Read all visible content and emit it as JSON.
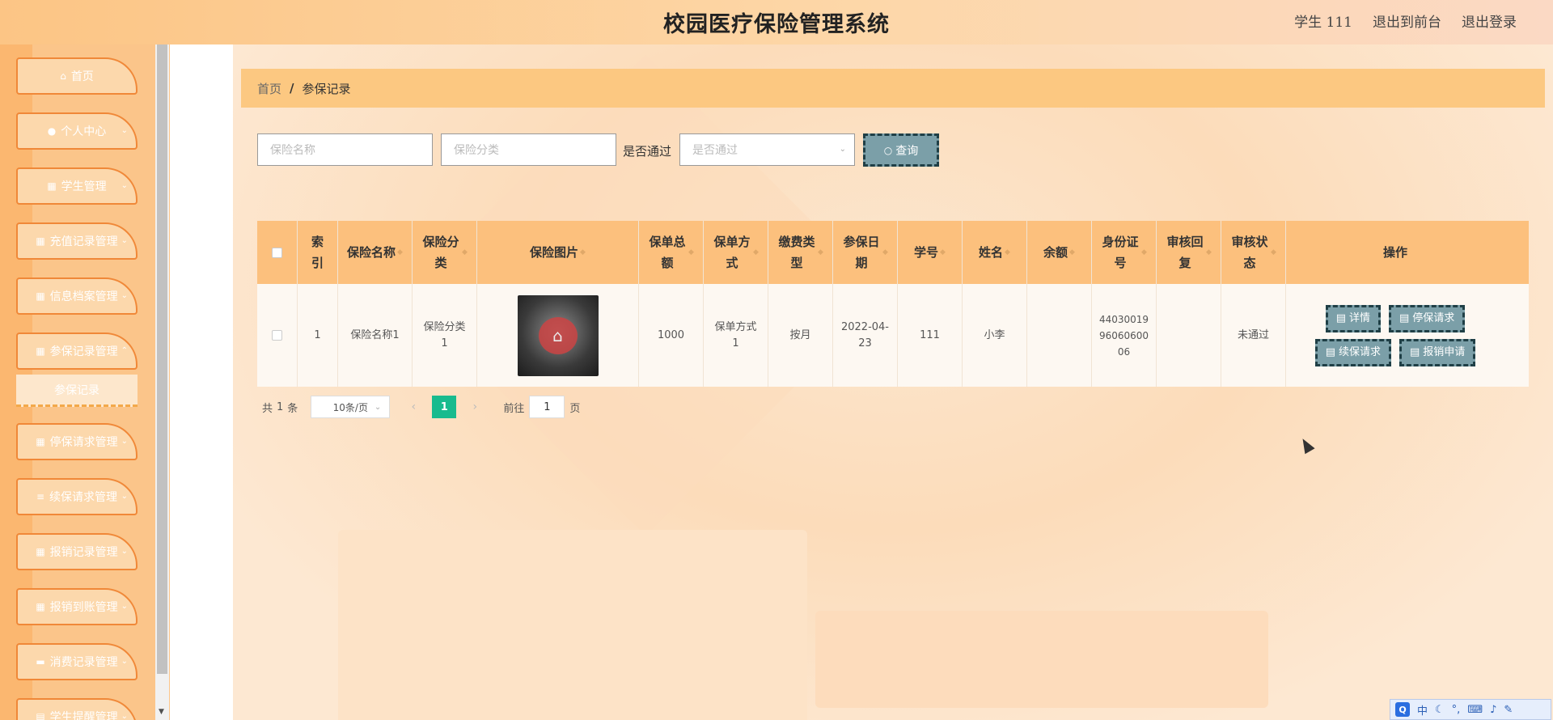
{
  "header": {
    "title": "校园医疗保险管理系统",
    "user": "学生 111",
    "back_to_front": "退出到前台",
    "logout": "退出登录"
  },
  "sidebar": {
    "items": [
      {
        "label": "首页",
        "icon": "home-icon"
      },
      {
        "label": "个人中心",
        "icon": "user-icon"
      },
      {
        "label": "学生管理",
        "icon": "grid-icon"
      },
      {
        "label": "充值记录管理",
        "icon": "grid-icon"
      },
      {
        "label": "信息档案管理",
        "icon": "grid-icon"
      },
      {
        "label": "参保记录管理",
        "icon": "grid-icon"
      },
      {
        "label": "停保请求管理",
        "icon": "grid-icon"
      },
      {
        "label": "续保请求管理",
        "icon": "list-icon"
      },
      {
        "label": "报销记录管理",
        "icon": "grid-icon"
      },
      {
        "label": "报销到账管理",
        "icon": "grid-icon"
      },
      {
        "label": "消费记录管理",
        "icon": "ticket-icon"
      },
      {
        "label": "学生提醒管理",
        "icon": "doc-icon"
      }
    ],
    "active_sub": "参保记录"
  },
  "breadcrumb": {
    "home": "首页",
    "sep": "/",
    "current": "参保记录"
  },
  "filters": {
    "name_placeholder": "保险名称",
    "category_placeholder": "保险分类",
    "approved_label": "是否通过",
    "approved_placeholder": "是否通过",
    "query_label": "查询"
  },
  "table": {
    "headers": [
      "索引",
      "保险名称",
      "保险分类",
      "保险图片",
      "保单总额",
      "保单方式",
      "缴费类型",
      "参保日期",
      "学号",
      "姓名",
      "余额",
      "身份证号",
      "审核回复",
      "审核状态",
      "操作"
    ],
    "rows": [
      {
        "index": "1",
        "name": "保险名称1",
        "category": "保险分类1",
        "total": "1000",
        "method": "保单方式1",
        "pay_type": "按月",
        "date": "2022-04-23",
        "student_no": "111",
        "student_name": "小李",
        "balance": "",
        "id_no": "440300199606060006",
        "review_reply": "",
        "review_status": "未通过",
        "actions": [
          "详情",
          "停保请求",
          "续保请求",
          "报销申请"
        ]
      }
    ]
  },
  "pagination": {
    "total_prefix": "共",
    "total": "1",
    "total_suffix": "条",
    "page_size": "10条/页",
    "current_page": "1",
    "goto_label": "前往",
    "goto_value": "1",
    "page_suffix": "页"
  },
  "ime": {
    "lang": "中"
  }
}
